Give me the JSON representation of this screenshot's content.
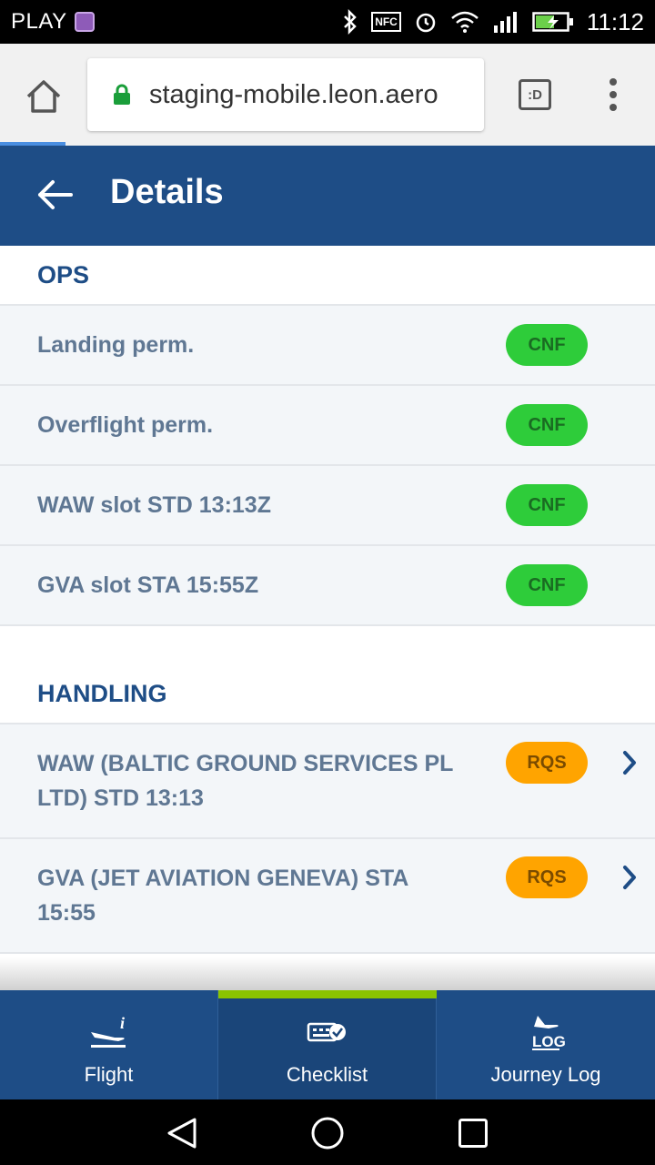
{
  "status_bar": {
    "carrier": "PLAY",
    "time": "11:12",
    "icons": [
      "gallery-icon",
      "bluetooth-icon",
      "nfc-icon",
      "alarm-icon",
      "wifi-icon",
      "signal-icon",
      "battery-charging-icon"
    ],
    "nfc_text": "NFC"
  },
  "browser": {
    "url": "staging-mobile.leon.aero",
    "tab_switch_label": ":D",
    "secure_color": "#1a9e3a"
  },
  "header": {
    "title": "Details"
  },
  "sections": [
    {
      "title": "OPS",
      "rows": [
        {
          "label": "Landing perm.",
          "status": "CNF"
        },
        {
          "label": "Overflight perm.",
          "status": "CNF"
        },
        {
          "label": "WAW slot STD 13:13Z",
          "status": "CNF"
        },
        {
          "label": "GVA slot STA 15:55Z",
          "status": "CNF"
        }
      ]
    },
    {
      "title": "HANDLING",
      "rows": [
        {
          "label": "WAW (BALTIC GROUND SERVICES PL LTD) STD 13:13",
          "status": "RQS"
        },
        {
          "label": "GVA (JET AVIATION GENEVA) STA 15:55",
          "status": "RQS"
        }
      ]
    }
  ],
  "bottom_nav": {
    "tabs": [
      {
        "label": "Flight",
        "icon": "flight-info-icon"
      },
      {
        "label": "Checklist",
        "icon": "checklist-icon",
        "active": true
      },
      {
        "label": "Journey Log",
        "icon": "journey-log-icon",
        "icon_text": "LOG"
      }
    ]
  },
  "colors": {
    "header_bg": "#1e4d86",
    "cnf": "#2ecc3a",
    "rqs": "#ffa400",
    "active_tab_indicator": "#8bc400"
  }
}
